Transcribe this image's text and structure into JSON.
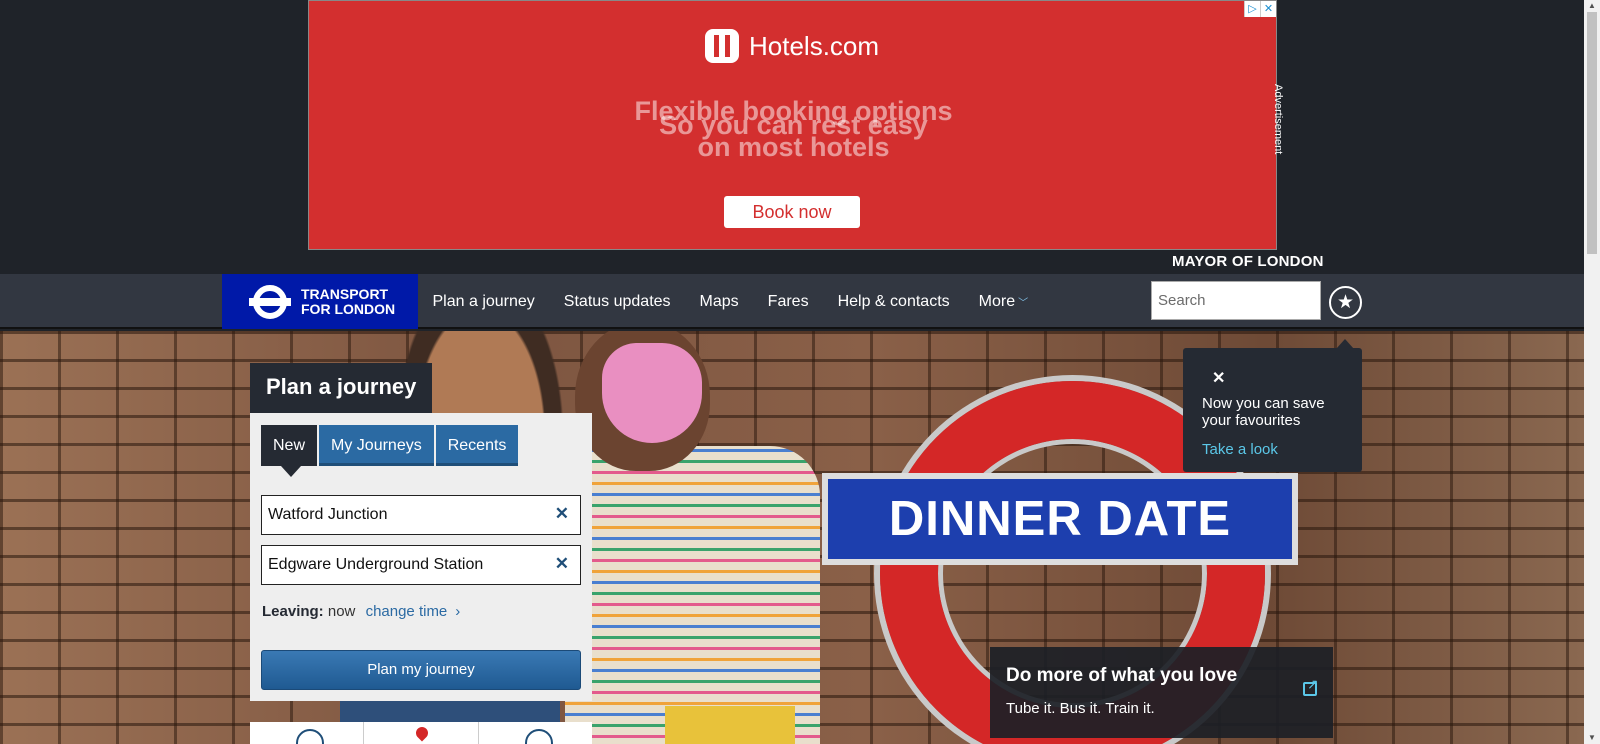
{
  "ad": {
    "brand": "Hotels.com",
    "line1": "Flexible booking options",
    "line2": "So you can rest easy",
    "line3": "on most hotels",
    "cta": "Book now",
    "label": "Advertisement"
  },
  "header": {
    "mayor": "MAYOR OF LONDON",
    "logo_line1": "TRANSPORT",
    "logo_line2": "FOR LONDON"
  },
  "nav": {
    "items": [
      "Plan a journey",
      "Status updates",
      "Maps",
      "Fares",
      "Help & contacts",
      "More"
    ],
    "search_placeholder": "Search"
  },
  "journey": {
    "title": "Plan a journey",
    "tabs": [
      "New",
      "My Journeys",
      "Recents"
    ],
    "from": "Watford Junction",
    "to": "Edgware Underground Station",
    "leaving_label": "Leaving:",
    "leaving_value": "now",
    "change_time": "change time",
    "submit": "Plan my journey"
  },
  "favourites_popup": {
    "message": "Now you can save your favourites",
    "link": "Take a look"
  },
  "hero": {
    "sign_text": "DINNER DATE"
  },
  "promo": {
    "title": "Do more of what you love",
    "subtitle": "Tube it. Bus it. Train it."
  },
  "colors": {
    "tfl_blue": "#0019a8",
    "nav_bg": "#323741",
    "ad_red": "#d32f2f",
    "link_cyan": "#5bc7e8"
  }
}
